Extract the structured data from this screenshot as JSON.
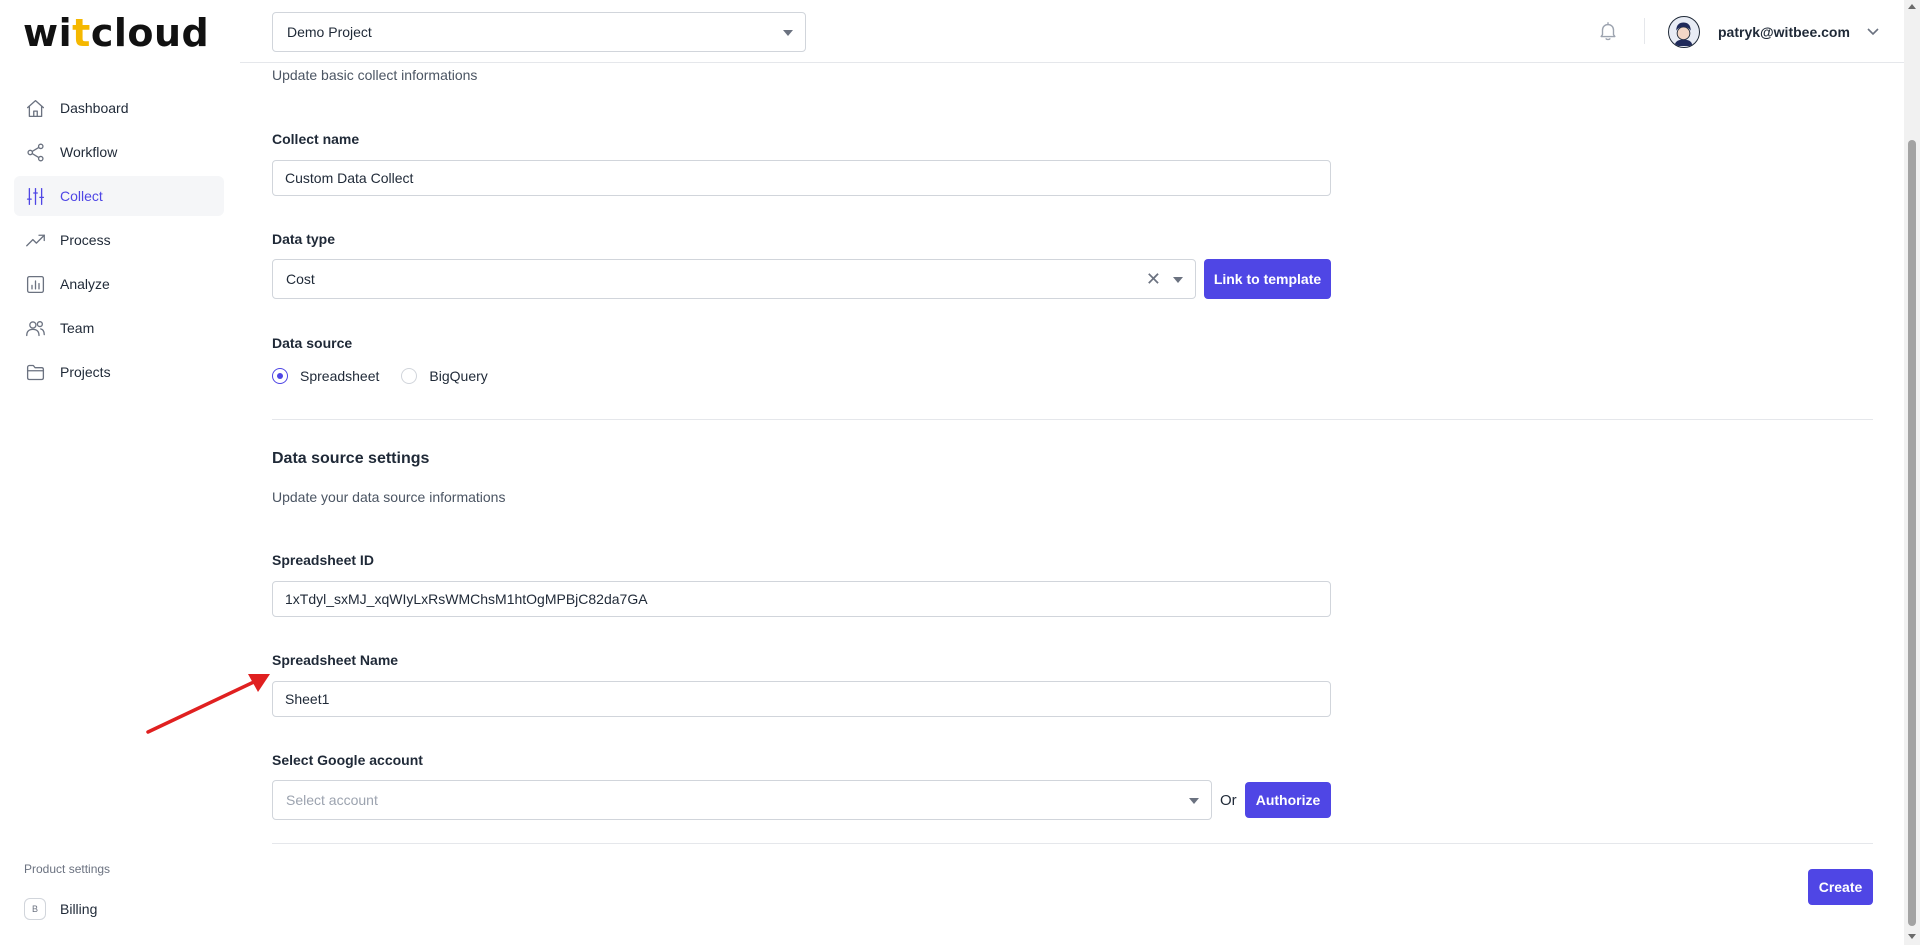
{
  "app": {
    "logo": {
      "part1": "wi",
      "part2": "t",
      "part3": "cloud"
    }
  },
  "sidebar": {
    "items": [
      {
        "label": "Dashboard",
        "icon": "home-icon"
      },
      {
        "label": "Workflow",
        "icon": "share-icon"
      },
      {
        "label": "Collect",
        "icon": "sliders-icon",
        "active": true
      },
      {
        "label": "Process",
        "icon": "trending-up-icon"
      },
      {
        "label": "Analyze",
        "icon": "bar-chart-icon"
      },
      {
        "label": "Team",
        "icon": "users-icon"
      },
      {
        "label": "Projects",
        "icon": "folder-icon"
      }
    ],
    "product_settings_label": "Product settings",
    "billing": {
      "badge": "B",
      "label": "Billing"
    }
  },
  "header": {
    "project_selected": "Demo Project",
    "user_email": "patryk@witbee.com"
  },
  "form": {
    "subtitle_basic": "Update basic collect informations",
    "collect_name": {
      "label": "Collect name",
      "value": "Custom Data Collect"
    },
    "data_type": {
      "label": "Data type",
      "value": "Cost",
      "link_button": "Link to template"
    },
    "data_source": {
      "label": "Data source",
      "options": [
        {
          "label": "Spreadsheet",
          "checked": true
        },
        {
          "label": "BigQuery",
          "checked": false
        }
      ]
    },
    "settings_section": {
      "title": "Data source settings",
      "subtitle": "Update your data source informations"
    },
    "spreadsheet_id": {
      "label": "Spreadsheet ID",
      "value": "1xTdyl_sxMJ_xqWIyLxRsWMChsM1htOgMPBjC82da7GA"
    },
    "spreadsheet_name": {
      "label": "Spreadsheet Name",
      "value": "Sheet1"
    },
    "google_account": {
      "label": "Select Google account",
      "placeholder": "Select account",
      "or_text": "Or",
      "authorize_button": "Authorize"
    },
    "create_button": "Create"
  },
  "colors": {
    "accent": "#4f46e5",
    "logo_accent": "#f5b800",
    "annotation": "#e02020"
  }
}
